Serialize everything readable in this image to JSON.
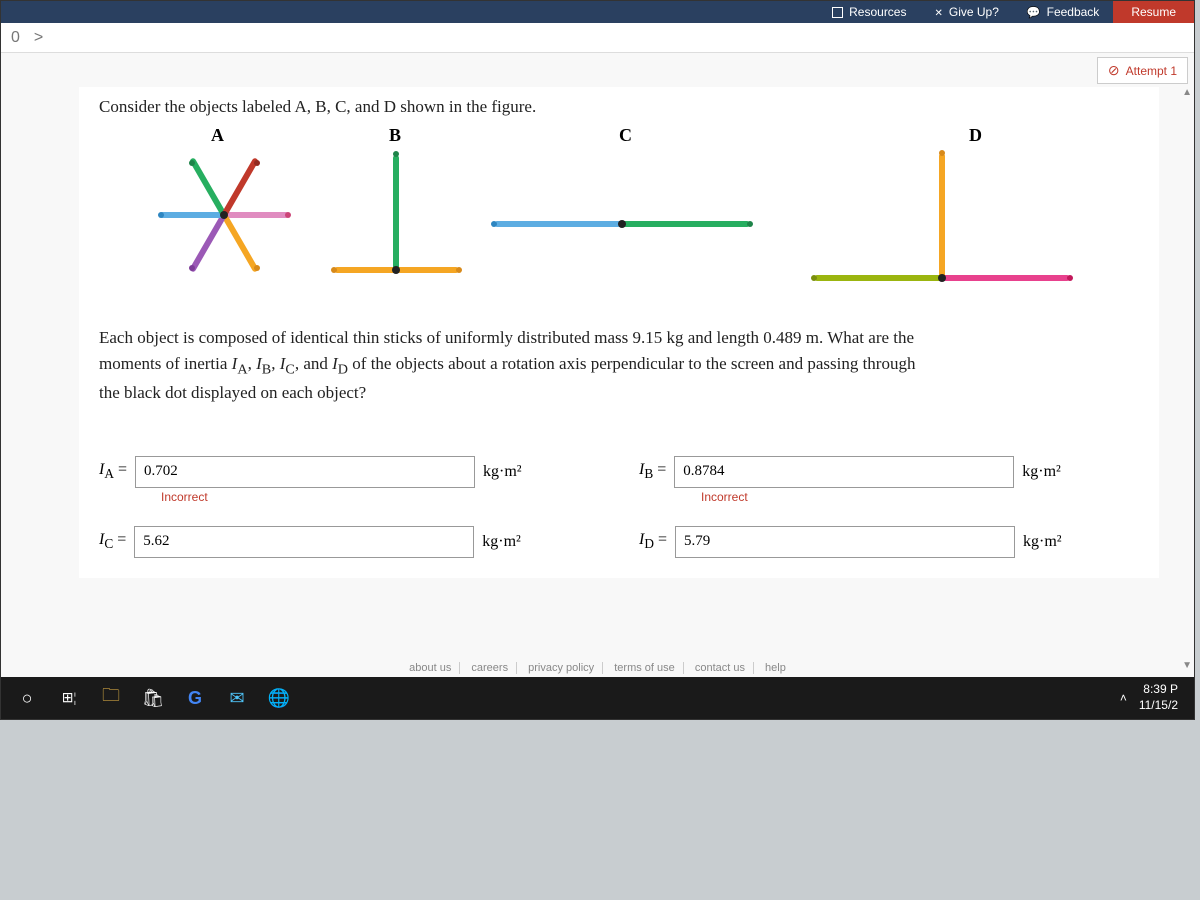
{
  "toolbar": {
    "resources": "Resources",
    "giveup": "Give Up?",
    "feedback": "Feedback",
    "resume": "Resume"
  },
  "nav": {
    "zero": "0",
    "arrow": ">"
  },
  "attempt": "Attempt 1",
  "prompt1": "Consider the objects labeled A, B, C, and D shown in the figure.",
  "labels": {
    "A": "A",
    "B": "B",
    "C": "C",
    "D": "D"
  },
  "prompt2a": "Each object is composed of identical thin sticks of uniformly distributed mass 9.15 kg and length 0.489 m. What are the",
  "prompt2b": "moments of inertia ",
  "prompt2c": " of the objects about a rotation axis perpendicular to the screen and passing through",
  "prompt2d": "the black dot displayed on each object?",
  "inertia_list": "I_A, I_B, I_C, and I_D",
  "answers": {
    "A": {
      "label_pre": "I",
      "sub": "A",
      "eq": " =",
      "value": "0.702",
      "unit": "kg·m²",
      "feedback": "Incorrect"
    },
    "B": {
      "label_pre": "I",
      "sub": "B",
      "eq": " =",
      "value": "0.8784",
      "unit": "kg·m²",
      "feedback": "Incorrect"
    },
    "C": {
      "label_pre": "I",
      "sub": "C",
      "eq": " =",
      "value": "5.62",
      "unit": "kg·m²",
      "feedback": ""
    },
    "D": {
      "label_pre": "I",
      "sub": "D",
      "eq": " =",
      "value": "5.79",
      "unit": "kg·m²",
      "feedback": ""
    }
  },
  "footer": {
    "about": "about us",
    "careers": "careers",
    "privacy": "privacy policy",
    "terms": "terms of use",
    "contact": "contact us",
    "help": "help"
  },
  "taskbar": {
    "time": "8:39 P",
    "date": "11/15/2"
  }
}
